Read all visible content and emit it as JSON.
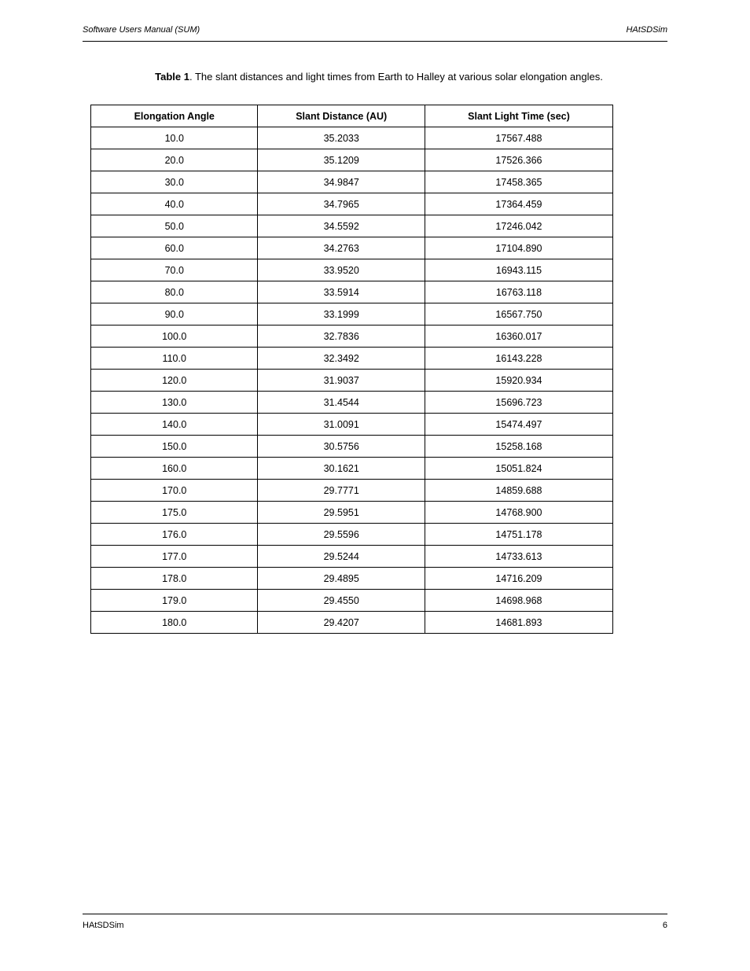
{
  "header": {
    "left": "Software Users Manual (SUM)",
    "right": "HAtSDSim"
  },
  "table": {
    "caption_prefix": "Table 1",
    "caption_text": ". The slant distances and light times from Earth to Halley at various solar elongation angles.",
    "headers": [
      "Elongation Angle",
      "Slant Distance (AU)",
      "Slant Light Time (sec)"
    ],
    "rows": [
      [
        "10.0",
        "35.2033",
        "17567.488"
      ],
      [
        "20.0",
        "35.1209",
        "17526.366"
      ],
      [
        "30.0",
        "34.9847",
        "17458.365"
      ],
      [
        "40.0",
        "34.7965",
        "17364.459"
      ],
      [
        "50.0",
        "34.5592",
        "17246.042"
      ],
      [
        "60.0",
        "34.2763",
        "17104.890"
      ],
      [
        "70.0",
        "33.9520",
        "16943.115"
      ],
      [
        "80.0",
        "33.5914",
        "16763.118"
      ],
      [
        "90.0",
        "33.1999",
        "16567.750"
      ],
      [
        "100.0",
        "32.7836",
        "16360.017"
      ],
      [
        "110.0",
        "32.3492",
        "16143.228"
      ],
      [
        "120.0",
        "31.9037",
        "15920.934"
      ],
      [
        "130.0",
        "31.4544",
        "15696.723"
      ],
      [
        "140.0",
        "31.0091",
        "15474.497"
      ],
      [
        "150.0",
        "30.5756",
        "15258.168"
      ],
      [
        "160.0",
        "30.1621",
        "15051.824"
      ],
      [
        "170.0",
        "29.7771",
        "14859.688"
      ],
      [
        "175.0",
        "29.5951",
        "14768.900"
      ],
      [
        "176.0",
        "29.5596",
        "14751.178"
      ],
      [
        "177.0",
        "29.5244",
        "14733.613"
      ],
      [
        "178.0",
        "29.4895",
        "14716.209"
      ],
      [
        "179.0",
        "29.4550",
        "14698.968"
      ],
      [
        "180.0",
        "29.4207",
        "14681.893"
      ]
    ]
  },
  "footer": {
    "left": "HAtSDSim",
    "right": "6"
  }
}
